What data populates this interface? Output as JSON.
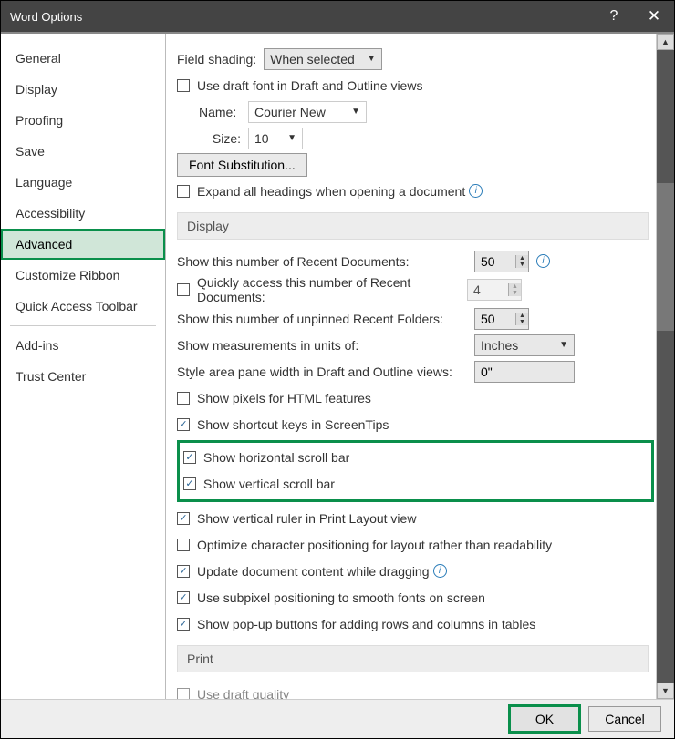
{
  "title": "Word Options",
  "sidebar": {
    "items": [
      "General",
      "Display",
      "Proofing",
      "Save",
      "Language",
      "Accessibility",
      "Advanced",
      "Customize Ribbon",
      "Quick Access Toolbar",
      "Add-ins",
      "Trust Center"
    ],
    "selected": "Advanced"
  },
  "top": {
    "field_shading": {
      "label": "Field shading:",
      "value": "When selected"
    },
    "draft_font": {
      "checked": false,
      "label": "Use draft font in Draft and Outline views"
    },
    "name_label": "Name:",
    "name_value": "Courier New",
    "size_label": "Size:",
    "size_value": "10",
    "font_sub_btn": "Font Substitution...",
    "expand_headings": {
      "checked": false,
      "label": "Expand all headings when opening a document"
    }
  },
  "sections": {
    "display": "Display",
    "print": "Print"
  },
  "display": {
    "recent_docs_label": "Show this number of Recent Documents:",
    "recent_docs_value": "50",
    "quick_access": {
      "checked": false,
      "label": "Quickly access this number of Recent Documents:",
      "value": "4"
    },
    "recent_folders_label": "Show this number of unpinned Recent Folders:",
    "recent_folders_value": "50",
    "measurements_label": "Show measurements in units of:",
    "measurements_value": "Inches",
    "style_area_label": "Style area pane width in Draft and Outline views:",
    "style_area_value": "0\"",
    "pixels": {
      "checked": false,
      "label": "Show pixels for HTML features"
    },
    "shortcut": {
      "checked": true,
      "label": "Show shortcut keys in ScreenTips"
    },
    "hscroll": {
      "checked": true,
      "label": "Show horizontal scroll bar"
    },
    "vscroll": {
      "checked": true,
      "label": "Show vertical scroll bar"
    },
    "vruler": {
      "checked": true,
      "label": "Show vertical ruler in Print Layout view"
    },
    "optimize": {
      "checked": false,
      "label": "Optimize character positioning for layout rather than readability"
    },
    "dragging": {
      "checked": true,
      "label": "Update document content while dragging"
    },
    "subpixel": {
      "checked": true,
      "label": "Use subpixel positioning to smooth fonts on screen"
    },
    "popup": {
      "checked": true,
      "label": "Show pop-up buttons for adding rows and columns in tables"
    }
  },
  "print": {
    "draft_quality": {
      "checked": false,
      "label": "Use draft quality"
    }
  },
  "footer": {
    "ok": "OK",
    "cancel": "Cancel"
  }
}
